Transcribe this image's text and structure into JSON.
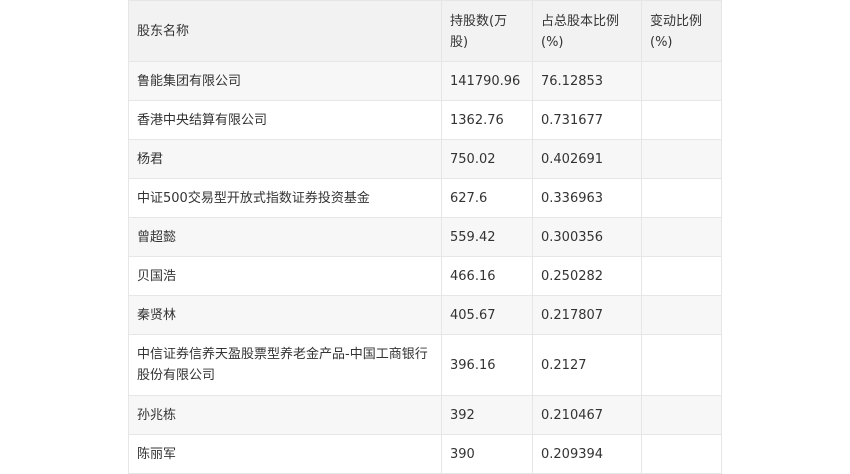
{
  "table": {
    "headers": {
      "name": "股东名称",
      "shares": "持股数(万股)",
      "pct": "占总股本比例(%)",
      "change": "变动比例(%)"
    },
    "rows": [
      {
        "name": "鲁能集团有限公司",
        "shares": "141790.96",
        "pct": "76.12853",
        "change": ""
      },
      {
        "name": "香港中央结算有限公司",
        "shares": "1362.76",
        "pct": "0.731677",
        "change": ""
      },
      {
        "name": "杨君",
        "shares": "750.02",
        "pct": "0.402691",
        "change": ""
      },
      {
        "name": "中证500交易型开放式指数证券投资基金",
        "shares": "627.6",
        "pct": "0.336963",
        "change": ""
      },
      {
        "name": "曾超懿",
        "shares": "559.42",
        "pct": "0.300356",
        "change": ""
      },
      {
        "name": "贝国浩",
        "shares": "466.16",
        "pct": "0.250282",
        "change": ""
      },
      {
        "name": "秦贤林",
        "shares": "405.67",
        "pct": "0.217807",
        "change": ""
      },
      {
        "name": "中信证券信养天盈股票型养老金产品-中国工商银行股份有限公司",
        "shares": "396.16",
        "pct": "0.2127",
        "change": ""
      },
      {
        "name": "孙兆栋",
        "shares": "392",
        "pct": "0.210467",
        "change": ""
      },
      {
        "name": "陈丽军",
        "shares": "390",
        "pct": "0.209394",
        "change": ""
      }
    ]
  }
}
